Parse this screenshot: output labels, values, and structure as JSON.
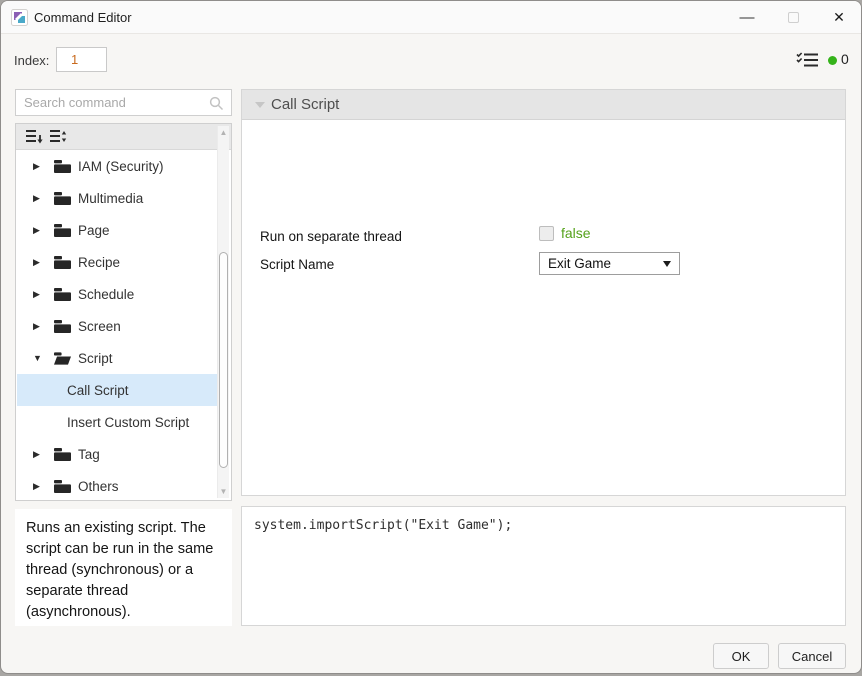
{
  "window": {
    "title": "Command Editor",
    "minimize_glyph": "—",
    "close_glyph": "✕"
  },
  "toolbar": {
    "index_label": "Index:",
    "index_value": "1",
    "counter_value": "0"
  },
  "search": {
    "placeholder": "Search command"
  },
  "tree": {
    "items": [
      {
        "label": "IAM (Security)",
        "type": "folder",
        "state": "collapsed"
      },
      {
        "label": "Multimedia",
        "type": "folder",
        "state": "collapsed"
      },
      {
        "label": "Page",
        "type": "folder",
        "state": "collapsed"
      },
      {
        "label": "Recipe",
        "type": "folder",
        "state": "collapsed"
      },
      {
        "label": "Schedule",
        "type": "folder",
        "state": "collapsed"
      },
      {
        "label": "Screen",
        "type": "folder",
        "state": "collapsed"
      },
      {
        "label": "Script",
        "type": "folder",
        "state": "expanded"
      },
      {
        "label": "Call Script",
        "type": "command",
        "selected": true
      },
      {
        "label": "Insert Custom Script",
        "type": "command",
        "selected": false
      },
      {
        "label": "Tag",
        "type": "folder",
        "state": "collapsed"
      },
      {
        "label": "Others",
        "type": "folder",
        "state": "collapsed"
      }
    ]
  },
  "panel": {
    "header": "Call Script",
    "fields": [
      {
        "label": "Run on separate thread",
        "control": "checkbox",
        "checked": false,
        "value": "false"
      },
      {
        "label": "Script Name",
        "control": "dropdown",
        "value": "Exit Game"
      }
    ]
  },
  "code": {
    "text": "system.importScript(\"Exit Game\");"
  },
  "description": {
    "text": "Runs an existing script. The script can be run in the same thread (synchronous) or a separate thread (asynchronous)."
  },
  "footer": {
    "ok_label": "OK",
    "cancel_label": "Cancel"
  },
  "colors": {
    "selected_row": "#d7eafa",
    "value_green": "#55a21b",
    "index_orange": "#c96a1e",
    "status_green": "#35b31a",
    "header_gray": "#e5e5e5"
  }
}
